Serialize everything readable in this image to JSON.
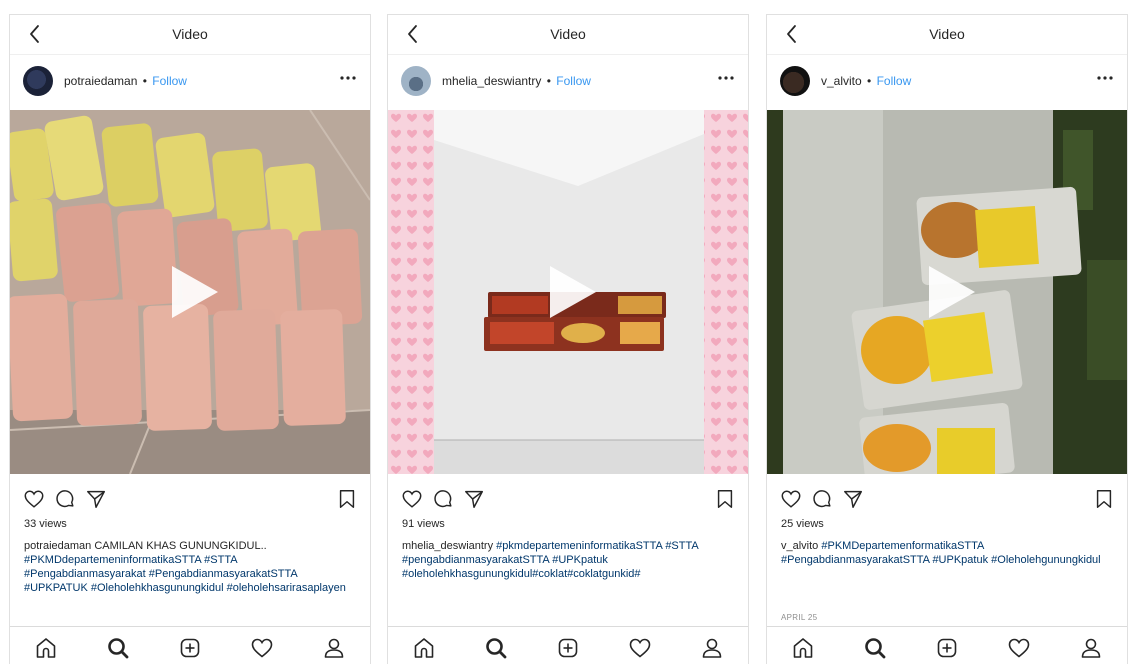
{
  "screens": [
    {
      "title": "Video",
      "username": "potraiedaman",
      "separator": "•",
      "follow_label": "Follow",
      "views": "33 views",
      "caption": "potraiedaman CAMILAN KHAS GUNUNGKIDUL..",
      "hashtags": "#PKMDdepartemeninformatikaSTTA #STTA #Pengabdianmasyarakat #PengabdianmasyarakatSTTA #UPKPATUK #Oleholehkhasgunungkidul #oleholehsarirasaplayen",
      "date": "",
      "media_description": "bags of crackers"
    },
    {
      "title": "Video",
      "username": "mhelia_deswiantry",
      "separator": "•",
      "follow_label": "Follow",
      "views": "91 views",
      "caption": "mhelia_deswiantry",
      "hashtags": "#pkmdepartemeninformatikaSTTA #STTA #pengabdianmasyarakatSTTA #UPKpatuk #oleholehkhasgunungkidul#coklat#coklatgunkid#",
      "date": "",
      "media_description": "chocolate boxes"
    },
    {
      "title": "Video",
      "username": "v_alvito",
      "separator": "•",
      "follow_label": "Follow",
      "views": "25 views",
      "caption": "v_alvito",
      "hashtags": "#PKMDepartemenformatikaSTTA #PengabdianmasyarakatSTTA #UPKpatuk #Oleholehgunungkidul",
      "date": "APRIL 25",
      "media_description": "packs of chips"
    }
  ],
  "icons": {
    "back": "chevron-left-icon",
    "more": "more-horizontal-icon",
    "play": "play-icon",
    "like": "heart-icon",
    "comment": "comment-icon",
    "share": "paper-plane-icon",
    "save": "bookmark-icon",
    "tabs": [
      "home-icon",
      "search-icon",
      "add-post-icon",
      "activity-heart-icon",
      "profile-icon"
    ]
  },
  "colors": {
    "follow": "#3897f0",
    "text": "#262626",
    "muted": "#8e8e8e",
    "hashtag": "#00376b",
    "border": "#dbdbdb"
  }
}
